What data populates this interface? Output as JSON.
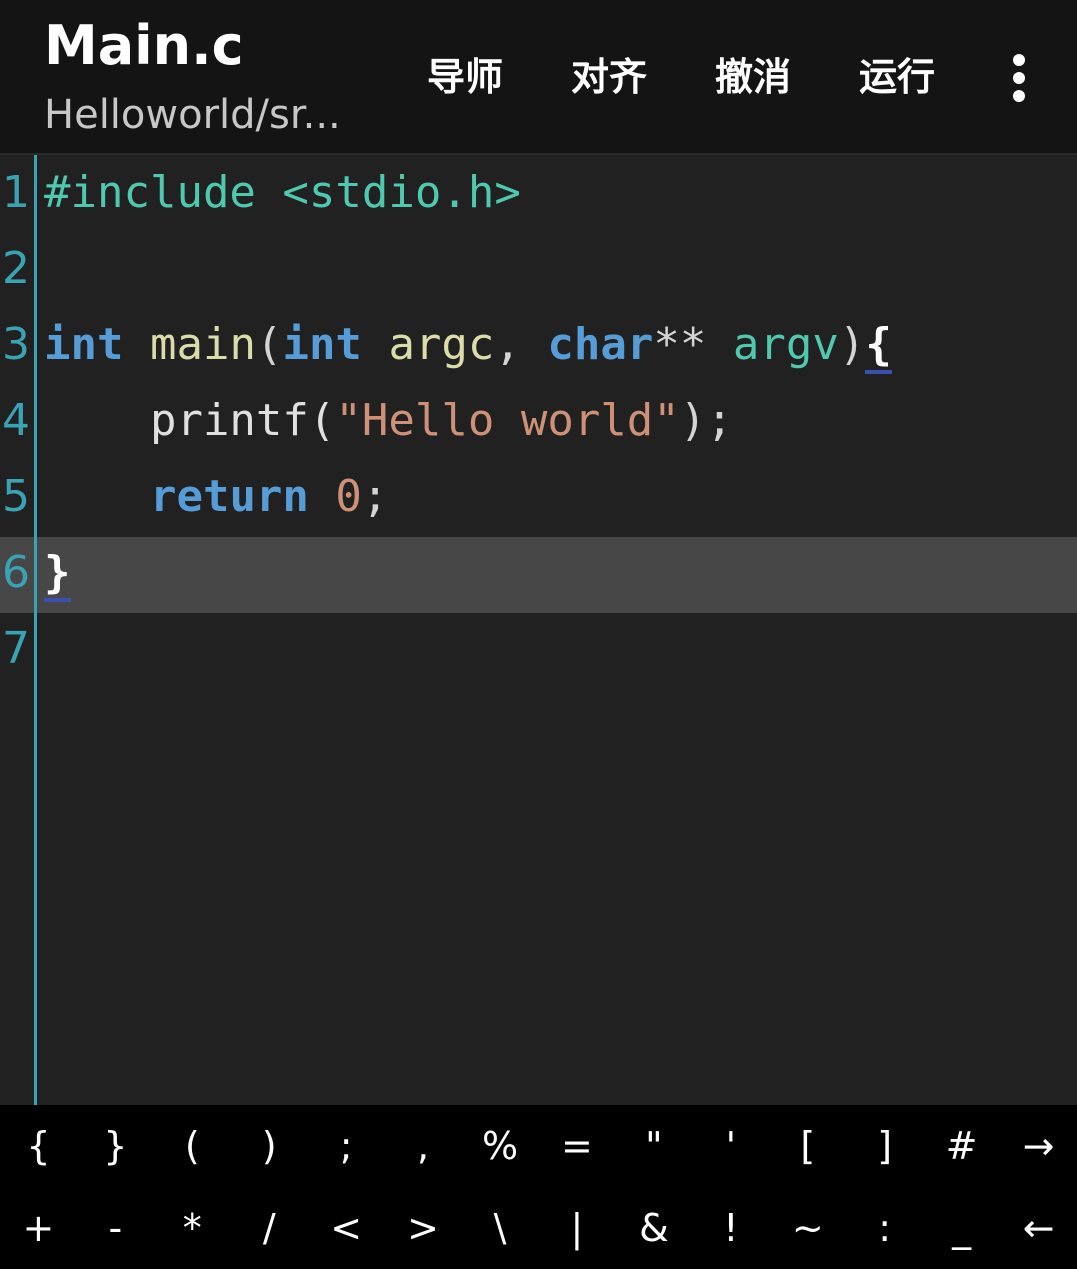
{
  "appbar": {
    "title": "Main.c",
    "subtitle": "Helloworld/sr...",
    "actions": [
      "导师",
      "对齐",
      "撤消",
      "运行"
    ],
    "more_icon": "more-vert-icon"
  },
  "editor": {
    "line_numbers": [
      "1",
      "2",
      "3",
      "4",
      "5",
      "6",
      "7"
    ],
    "current_line": 6,
    "lines": [
      {
        "tokens": [
          [
            "k-pre",
            "#include"
          ],
          [
            "k-plain",
            " "
          ],
          [
            "k-pre",
            "<stdio.h>"
          ]
        ]
      },
      {
        "tokens": []
      },
      {
        "tokens": [
          [
            "k-type",
            "int"
          ],
          [
            "k-plain",
            " "
          ],
          [
            "k-func",
            "main"
          ],
          [
            "k-pun",
            "("
          ],
          [
            "k-type",
            "int"
          ],
          [
            "k-plain",
            " "
          ],
          [
            "k-func",
            "argc"
          ],
          [
            "k-pun",
            ", "
          ],
          [
            "k-type",
            "char"
          ],
          [
            "k-pun",
            "** "
          ],
          [
            "k-id",
            "argv"
          ],
          [
            "k-pun",
            ")"
          ],
          [
            "k-brace",
            "{"
          ]
        ]
      },
      {
        "tokens": [
          [
            "k-plain",
            "    printf("
          ],
          [
            "k-str",
            "\"Hello world\""
          ],
          [
            "k-pun",
            ");"
          ]
        ]
      },
      {
        "tokens": [
          [
            "k-plain",
            "    "
          ],
          [
            "k-type",
            "return"
          ],
          [
            "k-plain",
            " "
          ],
          [
            "k-num",
            "0"
          ],
          [
            "k-pun",
            ";"
          ]
        ]
      },
      {
        "tokens": [
          [
            "k-brace",
            "}"
          ]
        ]
      },
      {
        "tokens": []
      }
    ]
  },
  "symbol_keys": {
    "row1": [
      "{",
      "}",
      "(",
      ")",
      ";",
      ",",
      "%",
      "=",
      "\"",
      "'",
      "[",
      "]",
      "#",
      "→"
    ],
    "row2": [
      "+",
      "-",
      "*",
      "/",
      "<",
      ">",
      "\\",
      "|",
      "&",
      "!",
      "~",
      ":",
      "_",
      "←"
    ]
  },
  "colors": {
    "accent": "#3aa3b3",
    "current_line_bg": "#474747",
    "editor_bg": "#212121",
    "appbar_bg": "#141414",
    "keys_bg": "#000000"
  }
}
